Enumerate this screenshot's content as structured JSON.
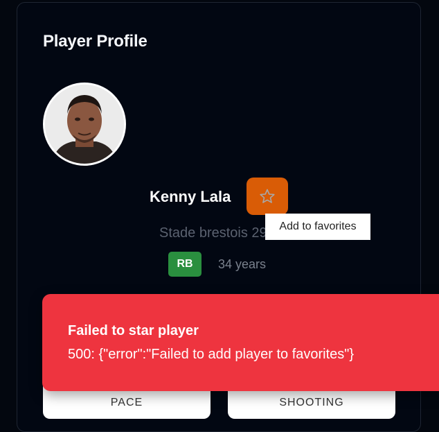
{
  "profile": {
    "title": "Player Profile",
    "player": {
      "name": "Kenny Lala",
      "club_line": "Stade brestois 29",
      "position": "RB",
      "age": "34 years"
    },
    "favorite_tooltip": "Add to favorites",
    "stat_tabs": [
      "PACE",
      "SHOOTING"
    ]
  },
  "toast": {
    "title": "Failed to star player",
    "message": "500: {\"error\":\"Failed to add player to favorites\"}"
  },
  "colors": {
    "accent": "#d95c06",
    "error": "#ee343f",
    "position_badge": "#2a8f3f"
  }
}
